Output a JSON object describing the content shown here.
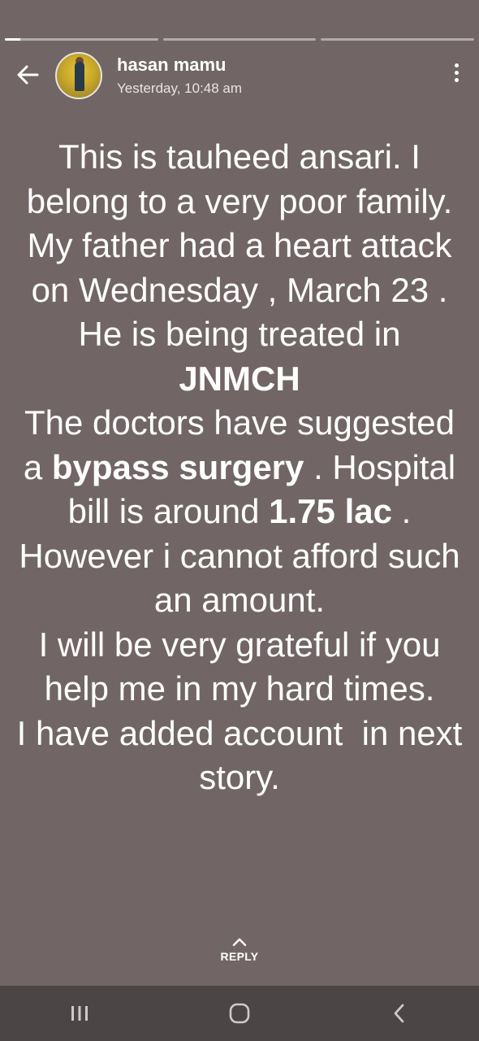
{
  "status": {
    "progress_segments": [
      0.1,
      0,
      0
    ]
  },
  "header": {
    "author": "hasan mamu",
    "timestamp": "Yesterday, 10:48 am",
    "back_icon": "arrow-left-icon",
    "menu_icon": "more-vertical-icon"
  },
  "story": {
    "part1": "This is tauheed ansari. I belong to a very poor family. My father had a heart attack on Wednesday , March 23 . He is being treated in",
    "hospital": "JNMCH",
    "part2": "The doctors have suggested a",
    "bold_bypass": "bypass",
    "bold_surgery": "surgery",
    "part3": ". Hospital bill is around",
    "bill_amount": "1.75 lac",
    "part4": ". However i cannot afford such an amount.",
    "part5": "I will be very grateful if you help me in my hard times.",
    "part6": "I have added account  in next story."
  },
  "reply": {
    "label": "REPLY",
    "icon": "chevron-up-icon"
  },
  "navbar": {
    "icons": [
      "recents-icon",
      "home-icon",
      "back-icon"
    ]
  },
  "colors": {
    "background": "#716665",
    "navbar": "#4b4545",
    "text": "#ffffff"
  }
}
